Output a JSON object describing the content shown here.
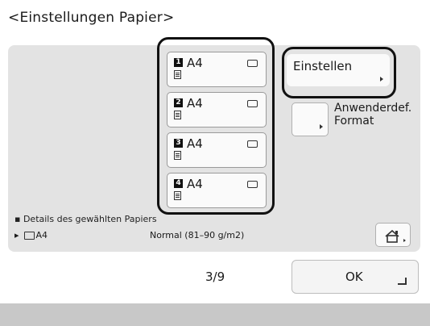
{
  "window": {
    "title": "<Einstellungen Papier>"
  },
  "trays": [
    {
      "number": "1",
      "size": "A4",
      "icon": "paper-icon"
    },
    {
      "number": "2",
      "size": "A4",
      "icon": "paper-icon"
    },
    {
      "number": "3",
      "size": "A4",
      "icon": "paper-icon"
    },
    {
      "number": "4",
      "size": "A4",
      "icon": "paper-icon"
    }
  ],
  "actions": {
    "set_label": "Einstellen",
    "custom_label": "Anwenderdef. Format"
  },
  "details": {
    "heading": "Details des gewählten Papiers",
    "size": "A4",
    "type": "Normal (81–90 g/m2)"
  },
  "footer": {
    "page": "3/9",
    "ok_label": "OK"
  }
}
